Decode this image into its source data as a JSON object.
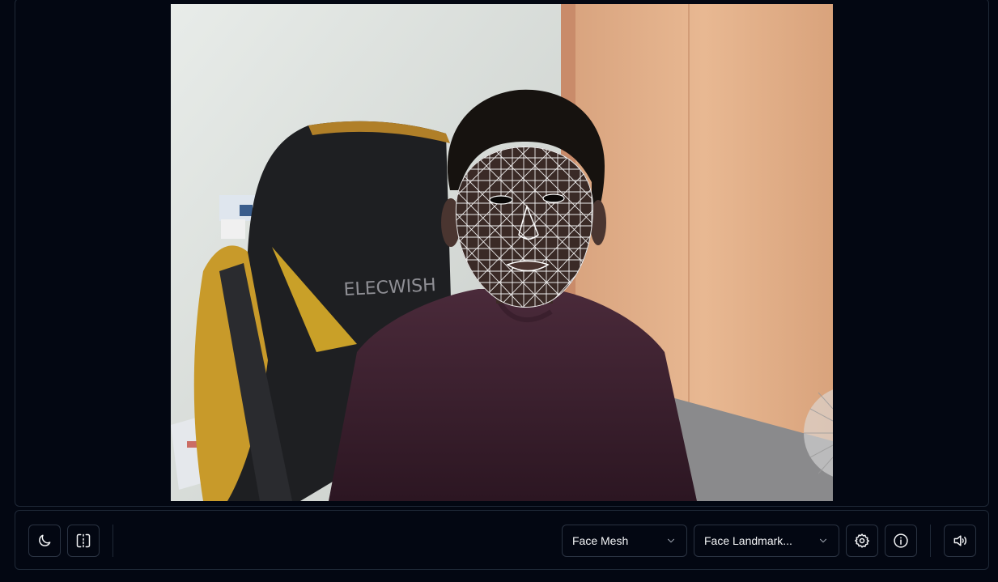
{
  "camera": {
    "overlay": "face mesh",
    "chair_brand": "ELECWISH"
  },
  "toolbar": {
    "theme_icon": "moon-icon",
    "mirror_icon": "flip-horizontal-icon",
    "model_select": {
      "value": "Face Mesh"
    },
    "task_select": {
      "value": "Face Landmark..."
    },
    "settings_icon": "gear-icon",
    "info_icon": "info-icon",
    "sound_icon": "volume-icon"
  },
  "colors": {
    "background": "#030712",
    "border": "#1f2937",
    "text": "#f3f4f6",
    "mesh": "#ffffff"
  }
}
